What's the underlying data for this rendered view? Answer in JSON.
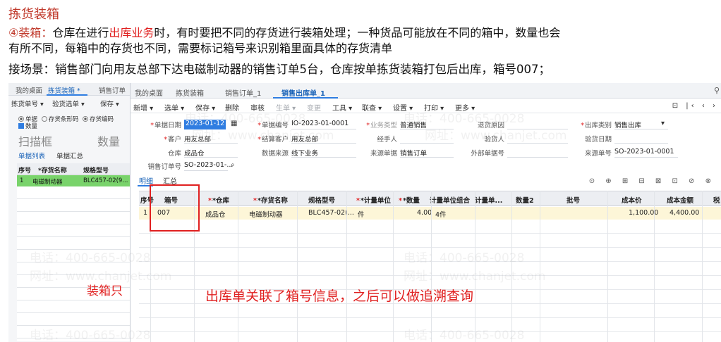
{
  "slide": {
    "title": "拣货装箱",
    "para1_lead": "④装箱：",
    "para1_a": "仓库在进行",
    "para1_hl": "出库业务",
    "para1_b": "时，有时要把不同的存货进行装箱处理；一种货品可能放在不同的箱中，数量也会",
    "para2": "有所不同，每箱中的存货也不同，需要标记箱号来识别箱里面具体的存货清单",
    "para3": "接场景：销售部门向用友总部下达电磁制动器的销售订单5台，仓库按单拣货装箱打包后出库，箱号007；"
  },
  "left": {
    "tabs": [
      "我的桌面",
      "拣货装箱 *",
      "销售订单"
    ],
    "tools": [
      "拣货单号 ▾",
      "验货选单 ▾",
      "保存 ▾"
    ],
    "radios": [
      "单据",
      "存货条形码",
      "存货编码"
    ],
    "checkbox": "数量",
    "scan_placeholder": "扫描框",
    "qty_placeholder": "数量",
    "subtabs": [
      "单据列表",
      "单据汇总"
    ],
    "headers": [
      "序号",
      "*存货名称",
      "规格型号"
    ],
    "row": [
      "1",
      "电磁制动器",
      "BLC457-02(9..."
    ],
    "label": "装箱只"
  },
  "right": {
    "tabs": [
      "我的桌面",
      "拣货装箱",
      "销售订单_1",
      "销售出库单_1"
    ],
    "tools": [
      "新增 ▾",
      "选单 ▾",
      "保存 ▾",
      "删除",
      "审核",
      "生单 ▾",
      "变更",
      "工具 ▾",
      "联查 ▾",
      "设置 ▾",
      "打印 ▾",
      "更多 ▾"
    ],
    "nav": "⊡ |‹ ‹ ›",
    "form": {
      "bill_date_label": "单据日期",
      "bill_date": "2023-01-12",
      "bill_no_label": "单据编号",
      "bill_no": "IO-2023-01-0001",
      "biz_type_label": "业务类型",
      "biz_type": "普通销售",
      "return_reason_label": "退货原因",
      "out_type_label": "出库类别",
      "out_type": "销售出库",
      "customer_label": "客户",
      "customer": "用友总部",
      "settle_customer_label": "结算客户",
      "settle_customer": "用友总部",
      "handler_label": "经手人",
      "inspector_label": "验货人",
      "inspect_date_label": "验货日期",
      "warehouse_label": "仓库",
      "warehouse": "成品仓",
      "data_source_label": "数据来源",
      "data_source": "线下业务",
      "source_bill_label": "来源单据",
      "source_bill": "销售订单",
      "ext_bill_label": "外部单据号",
      "source_no_label": "来源单号",
      "source_no": "SO-2023-01-0001",
      "so_no_label": "销售订单号",
      "so_no": "SO-2023-01-..."
    },
    "subtabs": [
      "明细",
      "汇总"
    ],
    "grid_icons": "⊙ ⊕ ⊞ ⊟ ⊠ ⊡ ⊘ ⊗",
    "headers": [
      "序号",
      "箱号",
      "*仓库",
      "*存货名称",
      "规格型号",
      "*计量单位",
      "*数量",
      "计量单位组合",
      "计量单...",
      "数量2",
      "批号",
      "成本价",
      "成本金额",
      "税"
    ],
    "row": [
      "1",
      "007",
      "成品仓",
      "电磁制动器",
      "BLC457-02(...",
      "件",
      "4.00",
      "4件",
      "",
      "",
      "",
      "1,100.00",
      "4,400.00"
    ],
    "note": "出库单关联了箱号信息，之后可以做追溯查询"
  },
  "watermark": {
    "phone": "电话：400-665-0028",
    "site": "网址：www.chanjet.com"
  }
}
